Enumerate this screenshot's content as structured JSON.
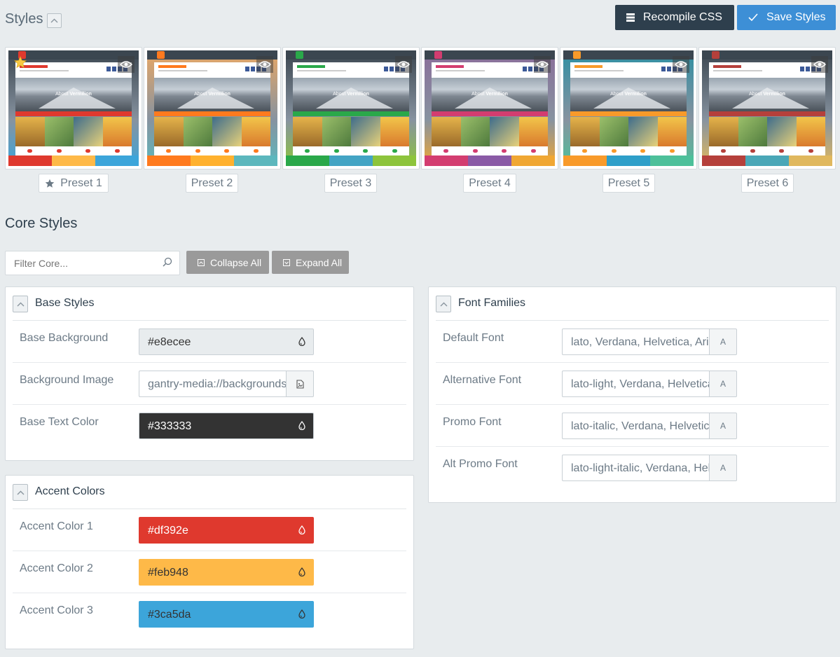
{
  "header": {
    "title": "Styles",
    "recompile_label": "Recompile CSS",
    "save_label": "Save Styles",
    "recompile_icon": "database-icon",
    "save_icon": "check-icon"
  },
  "presets": [
    {
      "label": "Preset 1",
      "active": true,
      "top": "#3b4650",
      "accent": "#df392e",
      "bars": [
        "#df392e",
        "#feb948",
        "#3ca5da"
      ]
    },
    {
      "label": "Preset 2",
      "active": false,
      "top": "#e8a765",
      "accent": "#ff7a1e",
      "bars": [
        "#ff7a1e",
        "#ffb12e",
        "#5cb7bd"
      ]
    },
    {
      "label": "Preset 3",
      "active": false,
      "top": "#3b4650",
      "accent": "#2aa84a",
      "bars": [
        "#2aa84a",
        "#43a4c4",
        "#8dc43c"
      ]
    },
    {
      "label": "Preset 4",
      "active": false,
      "top": "#8a6d9a",
      "accent": "#d33d70",
      "bars": [
        "#d33d70",
        "#8a5aa6",
        "#f0a733"
      ]
    },
    {
      "label": "Preset 5",
      "active": false,
      "top": "#2e8fa3",
      "accent": "#f89a2a",
      "bars": [
        "#f89a2a",
        "#2e9fc9",
        "#4dc09a"
      ]
    },
    {
      "label": "Preset 6",
      "active": false,
      "top": "#3b4650",
      "accent": "#b5403b",
      "bars": [
        "#b5403b",
        "#4aa7b7",
        "#e0b85e"
      ]
    }
  ],
  "core": {
    "title": "Core Styles",
    "filter_placeholder": "Filter Core...",
    "collapse_label": "Collapse All",
    "expand_label": "Expand All"
  },
  "base_styles": {
    "title": "Base Styles",
    "rows": [
      {
        "label": "Base Background",
        "value": "#e8ecee",
        "bg": "#e8ecee",
        "fg": "#333333",
        "icon": "droplet-icon"
      },
      {
        "label": "Background Image",
        "value": "gantry-media://backgrounds/",
        "bg": "#ffffff",
        "fg": "#6c7a86",
        "icon": "file-image-icon"
      },
      {
        "label": "Base Text Color",
        "value": "#333333",
        "bg": "#333333",
        "fg": "#ffffff",
        "icon": "droplet-icon"
      }
    ]
  },
  "accent_colors": {
    "title": "Accent Colors",
    "rows": [
      {
        "label": "Accent Color 1",
        "value": "#df392e",
        "bg": "#df392e",
        "fg": "#ffffff"
      },
      {
        "label": "Accent Color 2",
        "value": "#feb948",
        "bg": "#feb948",
        "fg": "#333333"
      },
      {
        "label": "Accent Color 3",
        "value": "#3ca5da",
        "bg": "#3ca5da",
        "fg": "#333333"
      }
    ]
  },
  "font_families": {
    "title": "Font Families",
    "rows": [
      {
        "label": "Default Font",
        "value": "lato, Verdana, Helvetica, Arial, sans-serif",
        "addon": "A"
      },
      {
        "label": "Alternative Font",
        "value": "lato-light, Verdana, Helvetica, Arial, sans-serif",
        "addon": "A"
      },
      {
        "label": "Promo Font",
        "value": "lato-italic, Verdana, Helvetica, Arial, sans-serif",
        "addon": "A"
      },
      {
        "label": "Alt Promo Font",
        "value": "lato-light-italic, Verdana, Helvetica, Arial, sans-serif",
        "addon": "A"
      }
    ]
  }
}
